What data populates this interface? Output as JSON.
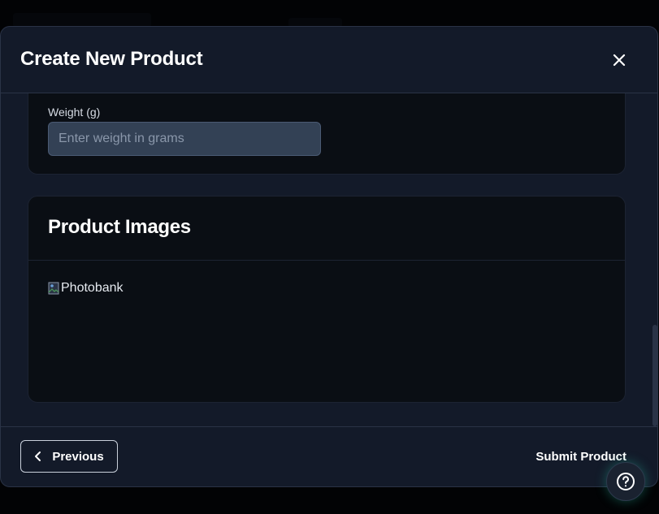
{
  "modal": {
    "title": "Create New Product"
  },
  "weight_field": {
    "label": "Weight (g)",
    "placeholder": "Enter weight in grams",
    "value": ""
  },
  "images_section": {
    "title": "Product Images",
    "image_alt": "Photobank"
  },
  "footer": {
    "previous_label": "Previous",
    "submit_label": "Submit Product"
  },
  "icons": {
    "close": "close-icon",
    "previous": "chevron-left-icon",
    "help": "help-circle-icon",
    "broken_image": "broken-image-icon"
  },
  "colors": {
    "modal_bg": "#131a29",
    "card_bg": "#0a0e14",
    "input_bg": "#334155",
    "help_glow": "#28c8aa"
  }
}
